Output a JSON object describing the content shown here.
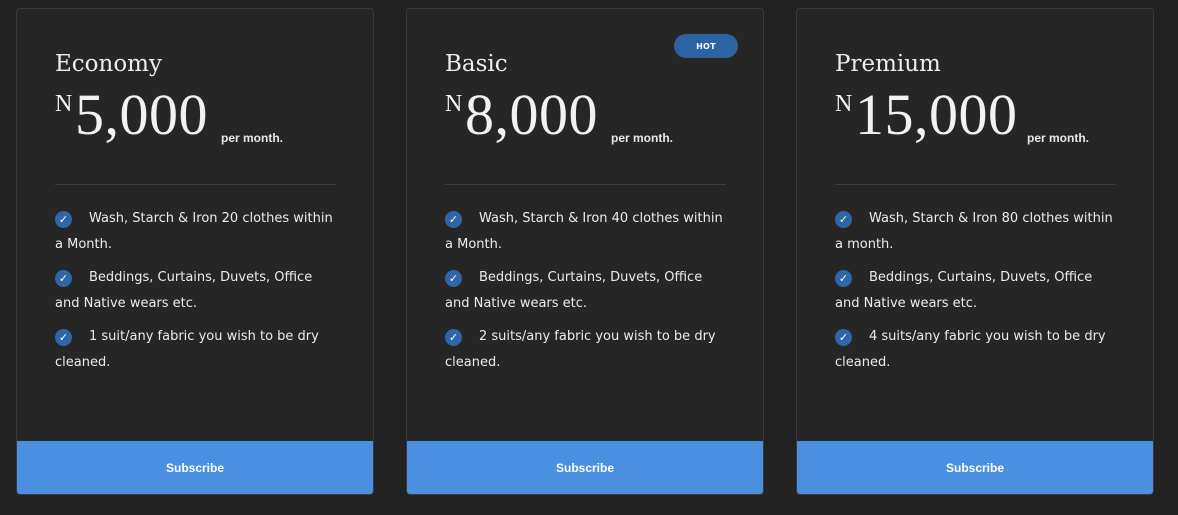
{
  "plans": [
    {
      "name": "Economy",
      "currency": "N",
      "price": "5,000",
      "period": "per month.",
      "features": [
        "Wash, Starch & Iron 20 clothes within a Month.",
        "Beddings, Curtains, Duvets, Office and Native wears etc.",
        "1 suit/any fabric you wish to be dry cleaned."
      ],
      "cta": "Subscribe"
    },
    {
      "name": "Basic",
      "badge": "HOT",
      "currency": "N",
      "price": "8,000",
      "period": "per month.",
      "features": [
        "Wash, Starch & Iron 40 clothes within a Month.",
        "Beddings, Curtains, Duvets, Office and Native wears etc.",
        "2 suits/any fabric you wish to be dry cleaned."
      ],
      "cta": "Subscribe"
    },
    {
      "name": "Premium",
      "currency": "N",
      "price": "15,000",
      "period": "per month.",
      "features": [
        "Wash, Starch & Iron 80 clothes within a month.",
        "Beddings, Curtains, Duvets, Office and Native wears etc.",
        "4 suits/any fabric you wish to be dry cleaned."
      ],
      "cta": "Subscribe"
    }
  ],
  "check_glyph": "✓",
  "icons": {
    "feature": "check-circle-icon"
  },
  "colors": {
    "background": "#222222",
    "card": "#262626",
    "accent": "#4a8fe0",
    "badge": "#2d62a3",
    "check": "#2f66a8",
    "text": "#ececec"
  }
}
